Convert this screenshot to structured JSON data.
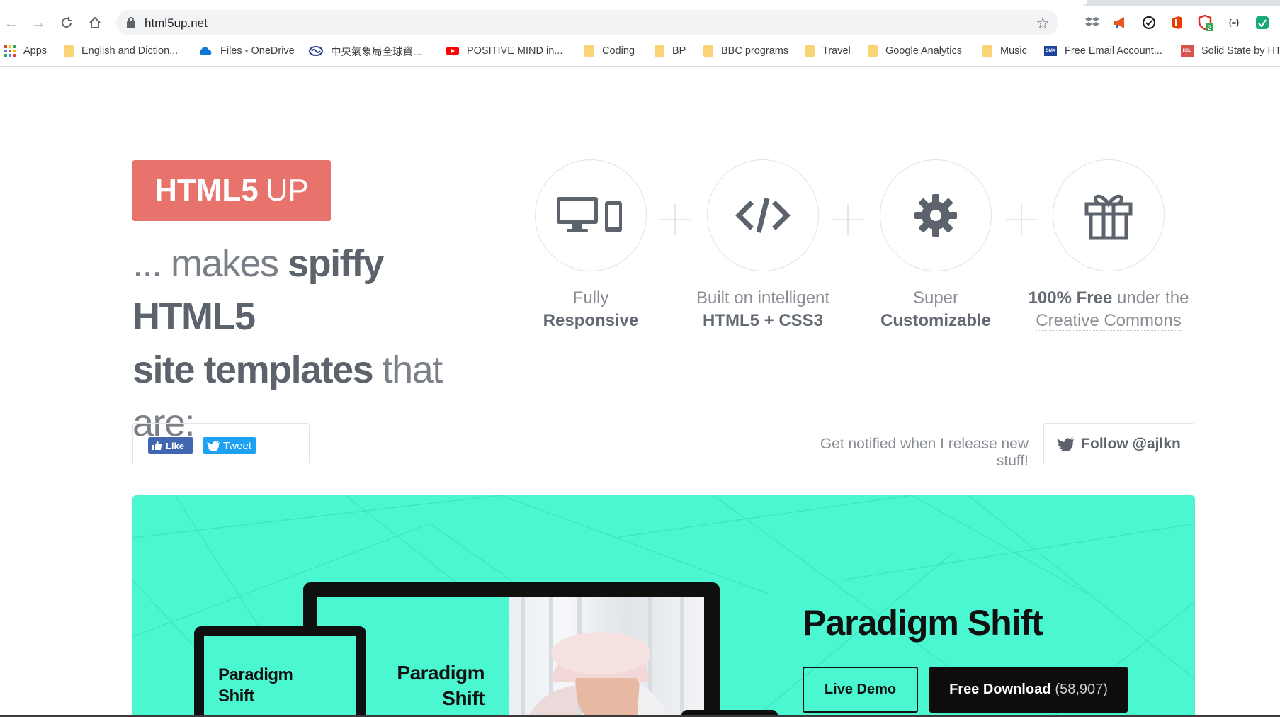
{
  "browser": {
    "url": "html5up.net",
    "bookmarks": [
      {
        "label": "Apps",
        "icon": "apps-grid-icon"
      },
      {
        "label": "English and Diction...",
        "icon": "folder-icon"
      },
      {
        "label": "Files - OneDrive",
        "icon": "onedrive-icon"
      },
      {
        "label": "中央氣象局全球資...",
        "icon": "cwb-icon"
      },
      {
        "label": "POSITIVE MIND in...",
        "icon": "youtube-icon"
      },
      {
        "label": "Coding",
        "icon": "folder-icon"
      },
      {
        "label": "BP",
        "icon": "folder-icon"
      },
      {
        "label": "BBC programs",
        "icon": "folder-icon"
      },
      {
        "label": "Travel",
        "icon": "folder-icon"
      },
      {
        "label": "Google Analytics",
        "icon": "folder-icon"
      },
      {
        "label": "Music",
        "icon": "folder-icon"
      },
      {
        "label": "Free Email Account...",
        "icon": "gmx-icon"
      },
      {
        "label": "Solid State by HTM",
        "icon": "hsu-icon"
      }
    ],
    "gmx_text": "GMX",
    "hsu_text": "HSU",
    "ext_badge": "2",
    "ext_json_text": "{≡}"
  },
  "page": {
    "logo_bold": "HTML5",
    "logo_light": "UP",
    "tagline": {
      "part1": "... makes ",
      "part2": "spiffy HTML5",
      "part3": "site templates",
      "part4": " that are:"
    },
    "features": [
      {
        "line1": "Fully",
        "line2": "Responsive"
      },
      {
        "line1": "Built on intelligent",
        "line2": "HTML5 + CSS3"
      },
      {
        "line1": "Super",
        "line2": "Customizable"
      },
      {
        "line1_bold": "100% Free",
        "line1_rest": " under the",
        "line2": "Creative Commons"
      }
    ],
    "social": {
      "like_label": "Like",
      "tweet_label": "Tweet",
      "notify_text": "Get notified when I release new stuff!",
      "follow_label": "Follow @ajlkn"
    },
    "hero": {
      "title": "Paradigm Shift",
      "live_demo_label": "Live Demo",
      "download_label": "Free Download",
      "download_count": "(58,907)",
      "device_text_line1": "Paradigm",
      "device_text_line2": "Shift"
    }
  },
  "colors": {
    "logo_bg": "#e8726c",
    "hero_bg": "#4af7d0",
    "text_dark": "#5d636d",
    "text_muted": "#8a8e95"
  }
}
